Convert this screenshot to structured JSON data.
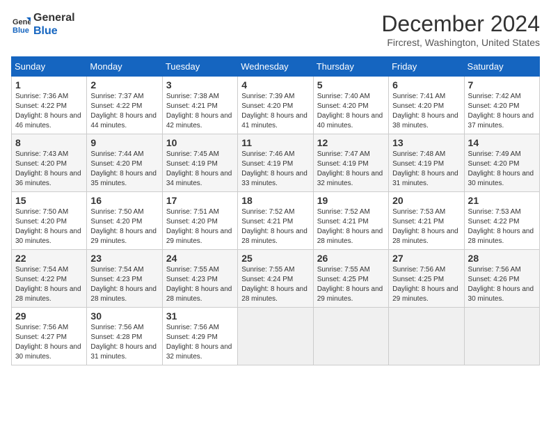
{
  "header": {
    "logo_line1": "General",
    "logo_line2": "Blue",
    "title": "December 2024",
    "subtitle": "Fircrest, Washington, United States"
  },
  "days_of_week": [
    "Sunday",
    "Monday",
    "Tuesday",
    "Wednesday",
    "Thursday",
    "Friday",
    "Saturday"
  ],
  "weeks": [
    [
      {
        "day": "1",
        "sunrise": "7:36 AM",
        "sunset": "4:22 PM",
        "daylight": "8 hours and 46 minutes."
      },
      {
        "day": "2",
        "sunrise": "7:37 AM",
        "sunset": "4:22 PM",
        "daylight": "8 hours and 44 minutes."
      },
      {
        "day": "3",
        "sunrise": "7:38 AM",
        "sunset": "4:21 PM",
        "daylight": "8 hours and 42 minutes."
      },
      {
        "day": "4",
        "sunrise": "7:39 AM",
        "sunset": "4:20 PM",
        "daylight": "8 hours and 41 minutes."
      },
      {
        "day": "5",
        "sunrise": "7:40 AM",
        "sunset": "4:20 PM",
        "daylight": "8 hours and 40 minutes."
      },
      {
        "day": "6",
        "sunrise": "7:41 AM",
        "sunset": "4:20 PM",
        "daylight": "8 hours and 38 minutes."
      },
      {
        "day": "7",
        "sunrise": "7:42 AM",
        "sunset": "4:20 PM",
        "daylight": "8 hours and 37 minutes."
      }
    ],
    [
      {
        "day": "8",
        "sunrise": "7:43 AM",
        "sunset": "4:20 PM",
        "daylight": "8 hours and 36 minutes."
      },
      {
        "day": "9",
        "sunrise": "7:44 AM",
        "sunset": "4:20 PM",
        "daylight": "8 hours and 35 minutes."
      },
      {
        "day": "10",
        "sunrise": "7:45 AM",
        "sunset": "4:19 PM",
        "daylight": "8 hours and 34 minutes."
      },
      {
        "day": "11",
        "sunrise": "7:46 AM",
        "sunset": "4:19 PM",
        "daylight": "8 hours and 33 minutes."
      },
      {
        "day": "12",
        "sunrise": "7:47 AM",
        "sunset": "4:19 PM",
        "daylight": "8 hours and 32 minutes."
      },
      {
        "day": "13",
        "sunrise": "7:48 AM",
        "sunset": "4:19 PM",
        "daylight": "8 hours and 31 minutes."
      },
      {
        "day": "14",
        "sunrise": "7:49 AM",
        "sunset": "4:20 PM",
        "daylight": "8 hours and 30 minutes."
      }
    ],
    [
      {
        "day": "15",
        "sunrise": "7:50 AM",
        "sunset": "4:20 PM",
        "daylight": "8 hours and 30 minutes."
      },
      {
        "day": "16",
        "sunrise": "7:50 AM",
        "sunset": "4:20 PM",
        "daylight": "8 hours and 29 minutes."
      },
      {
        "day": "17",
        "sunrise": "7:51 AM",
        "sunset": "4:20 PM",
        "daylight": "8 hours and 29 minutes."
      },
      {
        "day": "18",
        "sunrise": "7:52 AM",
        "sunset": "4:21 PM",
        "daylight": "8 hours and 28 minutes."
      },
      {
        "day": "19",
        "sunrise": "7:52 AM",
        "sunset": "4:21 PM",
        "daylight": "8 hours and 28 minutes."
      },
      {
        "day": "20",
        "sunrise": "7:53 AM",
        "sunset": "4:21 PM",
        "daylight": "8 hours and 28 minutes."
      },
      {
        "day": "21",
        "sunrise": "7:53 AM",
        "sunset": "4:22 PM",
        "daylight": "8 hours and 28 minutes."
      }
    ],
    [
      {
        "day": "22",
        "sunrise": "7:54 AM",
        "sunset": "4:22 PM",
        "daylight": "8 hours and 28 minutes."
      },
      {
        "day": "23",
        "sunrise": "7:54 AM",
        "sunset": "4:23 PM",
        "daylight": "8 hours and 28 minutes."
      },
      {
        "day": "24",
        "sunrise": "7:55 AM",
        "sunset": "4:23 PM",
        "daylight": "8 hours and 28 minutes."
      },
      {
        "day": "25",
        "sunrise": "7:55 AM",
        "sunset": "4:24 PM",
        "daylight": "8 hours and 28 minutes."
      },
      {
        "day": "26",
        "sunrise": "7:55 AM",
        "sunset": "4:25 PM",
        "daylight": "8 hours and 29 minutes."
      },
      {
        "day": "27",
        "sunrise": "7:56 AM",
        "sunset": "4:25 PM",
        "daylight": "8 hours and 29 minutes."
      },
      {
        "day": "28",
        "sunrise": "7:56 AM",
        "sunset": "4:26 PM",
        "daylight": "8 hours and 30 minutes."
      }
    ],
    [
      {
        "day": "29",
        "sunrise": "7:56 AM",
        "sunset": "4:27 PM",
        "daylight": "8 hours and 30 minutes."
      },
      {
        "day": "30",
        "sunrise": "7:56 AM",
        "sunset": "4:28 PM",
        "daylight": "8 hours and 31 minutes."
      },
      {
        "day": "31",
        "sunrise": "7:56 AM",
        "sunset": "4:29 PM",
        "daylight": "8 hours and 32 minutes."
      },
      null,
      null,
      null,
      null
    ]
  ]
}
